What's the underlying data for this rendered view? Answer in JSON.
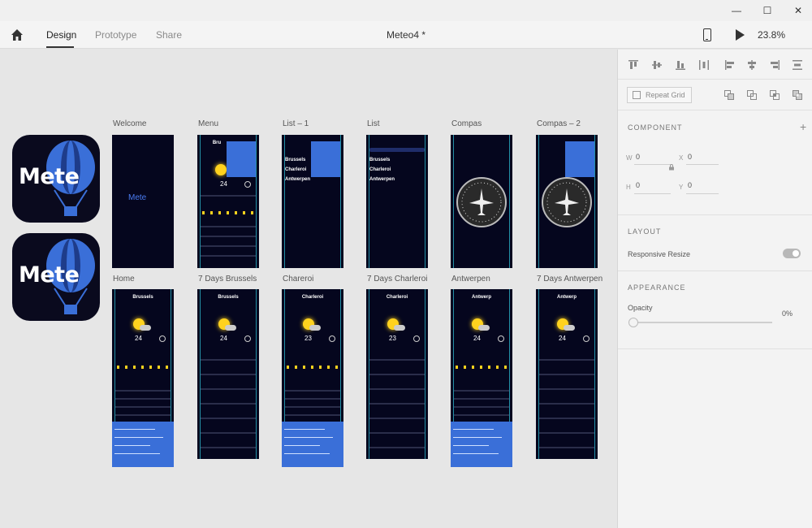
{
  "window": {
    "minimize_glyph": "—",
    "maximize_glyph": "☐",
    "close_glyph": "✕"
  },
  "toolbar": {
    "tabs": [
      {
        "label": "Design",
        "active": true
      },
      {
        "label": "Prototype",
        "active": false
      },
      {
        "label": "Share",
        "active": false
      }
    ],
    "document_title": "Meteo4 *",
    "zoom": "23.8%"
  },
  "assets": {
    "icon_text": "Mete"
  },
  "artboards": {
    "row1": [
      {
        "label": "Welcome",
        "kind": "welcome"
      },
      {
        "label": "Menu",
        "kind": "menu"
      },
      {
        "label": "List – 1",
        "kind": "list-menu"
      },
      {
        "label": "List",
        "kind": "list"
      },
      {
        "label": "Compas",
        "kind": "compas"
      },
      {
        "label": "Compas – 2",
        "kind": "compas-menu"
      }
    ],
    "row2": [
      {
        "label": "Home",
        "kind": "home"
      },
      {
        "label": "7 Days Brussels",
        "kind": "days"
      },
      {
        "label": "Chareroi",
        "kind": "home"
      },
      {
        "label": "7 Days Charleroi",
        "kind": "days"
      },
      {
        "label": "Antwerpen",
        "kind": "home"
      },
      {
        "label": "7 Days Antwerpen",
        "kind": "days"
      }
    ],
    "welcome_text": "Mete",
    "menu_city": "Bru",
    "menu_temp": "24",
    "list_items": [
      "Brussels",
      "Charleroi",
      "Antwerpen"
    ],
    "home_cities": [
      "Brussels",
      "Charleroi",
      "Antwerp"
    ],
    "days_cities": [
      "Brussels",
      "Charleroi",
      "Antwerp"
    ],
    "home_temps": [
      "24",
      "23",
      "24"
    ],
    "days_temps": [
      "24",
      "23",
      "24"
    ]
  },
  "right_panel": {
    "repeat_grid_label": "Repeat Grid",
    "component_title": "COMPONENT",
    "add_glyph": "+",
    "w_label": "W",
    "w_value": "0",
    "x_label": "X",
    "x_value": "0",
    "h_label": "H",
    "h_value": "0",
    "y_label": "Y",
    "y_value": "0",
    "layout_title": "LAYOUT",
    "responsive_resize_label": "Responsive Resize",
    "appearance_title": "APPEARANCE",
    "opacity_label": "Opacity",
    "opacity_value": "0%"
  },
  "colors": {
    "artboard_bg": "#05061e",
    "accent_blue": "#3a6fd8",
    "guide_cyan": "#2ab3c8"
  }
}
